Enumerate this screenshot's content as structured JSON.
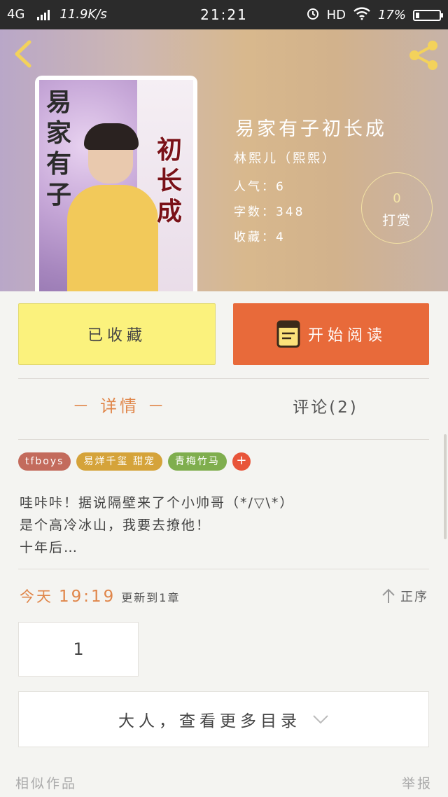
{
  "status_bar": {
    "network": "4G",
    "speed": "11.9K/s",
    "time": "21:21",
    "hd": "HD",
    "battery": "17%",
    "battery_level": 0.17
  },
  "book": {
    "title": "易家有子初长成",
    "author": "林熙儿（熙熙）",
    "popularity": "人气：6",
    "word_count": "字数：348",
    "favorites": "收藏：4",
    "cover_text_left": "易家有子",
    "cover_text_right": "初长成"
  },
  "tip": {
    "count": "0",
    "label": "打赏"
  },
  "actions": {
    "favorited_label": "已收藏",
    "read_label": "开始阅读"
  },
  "tabs": {
    "detail": "－ 详情 －",
    "comments": "评论(2)"
  },
  "tags": [
    {
      "label": "tfboys",
      "color": "#c36b5c"
    },
    {
      "label": "易烊千玺  甜宠",
      "color": "#d5a33a"
    },
    {
      "label": "青梅竹马",
      "color": "#7fae4e"
    }
  ],
  "tag_add": "+",
  "intro": {
    "line1": "哇咔咔！据说隔壁来了个小帅哥（*/▽\\*）",
    "line2": "是个高冷冰山，我要去撩他！",
    "line3": "十年后…"
  },
  "update": {
    "day": "今天",
    "time": "19:19",
    "text": "更新到1章"
  },
  "order_label": "正序",
  "chapters": [
    "1"
  ],
  "more_catalog": "大人，查看更多目录",
  "footer": {
    "similar": "相似作品",
    "report": "举报"
  },
  "colors": {
    "accent": "#e86a3a",
    "favorite_bg": "#fbf27d",
    "highlight": "#e0864a"
  }
}
